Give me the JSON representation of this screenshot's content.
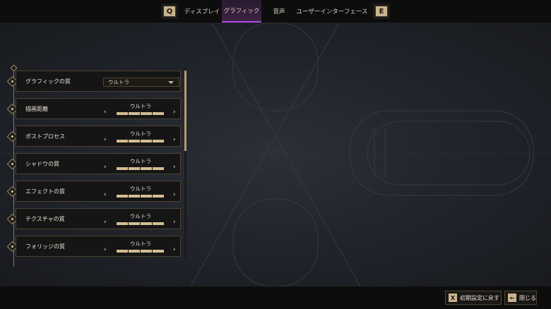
{
  "tabs": {
    "left_key": "Q",
    "right_key": "E",
    "items": [
      {
        "label": "ディスプレイ",
        "active": false
      },
      {
        "label": "グラフィック",
        "active": true
      },
      {
        "label": "音声",
        "active": false
      },
      {
        "label": "ユーザーインターフェース",
        "active": false
      }
    ]
  },
  "settings": {
    "graphics_quality": {
      "label": "グラフィックの質",
      "value": "ウルトラ"
    },
    "rows": [
      {
        "label": "描画距離",
        "value": "ウルトラ",
        "level": 4,
        "max": 4
      },
      {
        "label": "ポストプロセス",
        "value": "ウルトラ",
        "level": 4,
        "max": 4
      },
      {
        "label": "シャドウの質",
        "value": "ウルトラ",
        "level": 4,
        "max": 4
      },
      {
        "label": "エフェクトの質",
        "value": "ウルトラ",
        "level": 4,
        "max": 4
      },
      {
        "label": "テクスチャの質",
        "value": "ウルトラ",
        "level": 4,
        "max": 4
      },
      {
        "label": "フォリッジの質",
        "value": "ウルトラ",
        "level": 4,
        "max": 4
      }
    ]
  },
  "footer": {
    "reset": {
      "key": "X",
      "label": "初期設定に戻す"
    },
    "close": {
      "key": "←",
      "label": "閉じる"
    }
  },
  "colors": {
    "accent_gold": "#c9b48e",
    "active_tab_underline": "#b44be0",
    "background": "#22252b"
  }
}
